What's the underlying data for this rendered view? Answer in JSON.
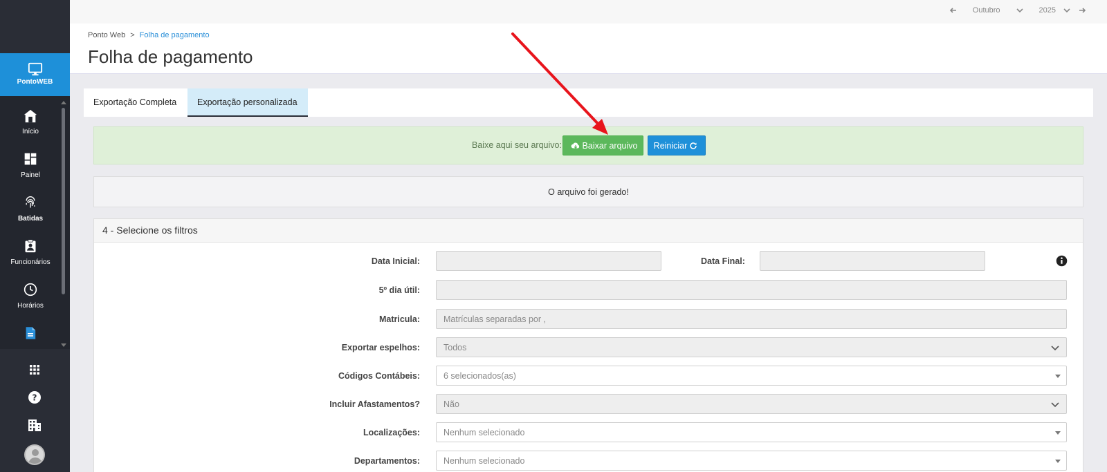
{
  "sidebar": {
    "brand": "PontoWEB",
    "items": [
      {
        "label": "Início",
        "icon": "home-icon"
      },
      {
        "label": "Painel",
        "icon": "dashboard-icon"
      },
      {
        "label": "Batidas",
        "icon": "fingerprint-icon"
      },
      {
        "label": "Funcionários",
        "icon": "clipboard-user-icon"
      },
      {
        "label": "Horários",
        "icon": "clock-icon"
      },
      {
        "label": "",
        "icon": "document-icon"
      }
    ],
    "bottom_icons": [
      "apps-grid-icon",
      "help-icon",
      "building-icon",
      "avatar"
    ]
  },
  "topbar": {
    "month": "Outubro",
    "year": "2025"
  },
  "header": {
    "breadcrumb_root": "Ponto Web",
    "breadcrumb_sep": ">",
    "breadcrumb_current": "Folha de pagamento",
    "title": "Folha de pagamento"
  },
  "tabs": [
    {
      "label": "Exportação Completa",
      "active": false
    },
    {
      "label": "Exportação personalizada",
      "active": true
    }
  ],
  "alert": {
    "text": "Baixe aqui seu arquivo:",
    "download_label": "Baixar arquivo",
    "restart_label": "Reiniciar"
  },
  "well": {
    "message": "O arquivo foi gerado!"
  },
  "filters": {
    "title": "4 - Selecione os filtros",
    "data_inicial_label": "Data Inicial:",
    "data_final_label": "Data Final:",
    "quinto_dia_label": "5º dia útil:",
    "matricula_label": "Matricula:",
    "matricula_placeholder": "Matrículas separadas por ,",
    "exportar_espelhos_label": "Exportar espelhos:",
    "exportar_espelhos_value": "Todos",
    "codigos_label": "Códigos Contábeis:",
    "codigos_value": "6 selecionados(as)",
    "afastamentos_label": "Incluir Afastamentos?",
    "afastamentos_value": "Não",
    "localizacoes_label": "Localizações:",
    "localizacoes_value": "Nenhum selecionado",
    "departamentos_label": "Departamentos:",
    "departamentos_value": "Nenhum selecionado"
  },
  "colors": {
    "sidebar_bg": "#2a2d36",
    "brand_blue": "#1e90d9",
    "success_green": "#5cb85c",
    "alert_bg": "#dff0d8",
    "annotation_red": "#e8141c"
  }
}
